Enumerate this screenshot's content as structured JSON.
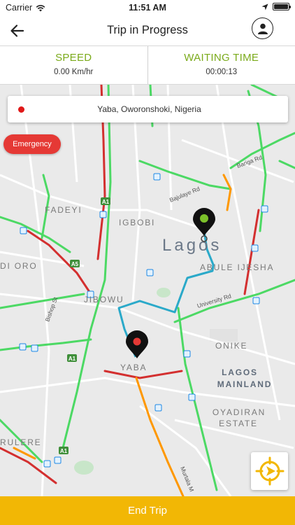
{
  "status_bar": {
    "carrier": "Carrier",
    "time": "11:51 AM"
  },
  "header": {
    "title": "Trip in Progress",
    "back_icon": "arrow-left-icon",
    "profile_icon": "user-icon"
  },
  "stats": {
    "speed": {
      "label": "SPEED",
      "value": "0.00 Km/hr"
    },
    "waiting": {
      "label": "WAITING TIME",
      "value": "00:00:13"
    }
  },
  "location": {
    "address": "Yaba, Oworonshoki, Nigeria"
  },
  "emergency": {
    "label": "Emergency"
  },
  "map": {
    "labels": {
      "lagos": "Lagos",
      "fadeyi": "FADEYI",
      "igbobi": "IGBOBI",
      "abule_ijesha": "ABULE IJESHA",
      "jibowu": "JIBOWU",
      "onike": "ONIKE",
      "yaba": "YABA",
      "lagos_mainland_1": "LAGOS",
      "lagos_mainland_2": "MAINLAND",
      "oyadiran_1": "OYADIRAN",
      "oyadiran_2": "ESTATE",
      "oro": "DI ORO",
      "surulere": "RULERE",
      "university_rd": "University Rd",
      "bajulaye_rd": "Bajulaye Rd",
      "bariga_rd": "Bariga Rd",
      "bishop_st": "Bishop St",
      "murtala": "Murtala M",
      "a1_top": "A1",
      "a5": "A5",
      "a1_mid": "A1",
      "a1_bottom": "A1"
    },
    "colors": {
      "route": "#2aa9c9",
      "traffic_green": "#4cd964",
      "traffic_red": "#d32f2f",
      "traffic_orange": "#ff9800",
      "origin_pin": "#7cc12a",
      "destination_pin": "#e53935"
    }
  },
  "recenter_icon": "crosshair-icon",
  "footer": {
    "end_trip_label": "End Trip"
  }
}
